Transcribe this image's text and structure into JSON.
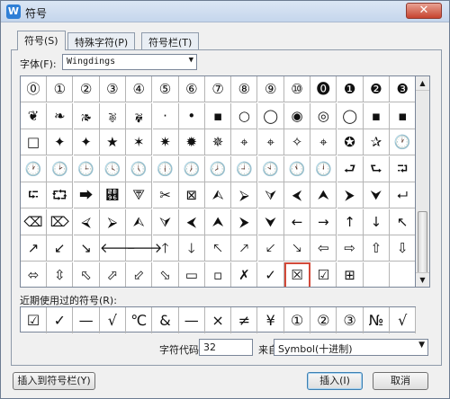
{
  "window": {
    "title": "符号",
    "app_icon": "W",
    "close_glyph": "✕"
  },
  "tabs": [
    {
      "label": "符号(S)"
    },
    {
      "label": "特殊字符(P)"
    },
    {
      "label": "符号栏(T)"
    }
  ],
  "font": {
    "label": "字体(F):",
    "value": "Wingdings",
    "dropdown_icon": "chevron-down-icon"
  },
  "symbol_grid": {
    "rows": [
      [
        "⓪",
        "①",
        "②",
        "③",
        "④",
        "⑤",
        "⑥",
        "⑦",
        "⑧",
        "⑨",
        "⑩",
        "⓿",
        "❶",
        "❷",
        "❸"
      ],
      [
        "❦",
        "❧",
        "🙕",
        "🙖",
        "🙗",
        "·",
        "•",
        "▪",
        "○",
        "◯",
        "◉",
        "◎",
        "◯",
        "▪",
        "▪"
      ],
      [
        "□",
        "✦",
        "✦",
        "★",
        "✶",
        "✷",
        "✹",
        "✵",
        "⌖",
        "⌖",
        "✧",
        "⌖",
        "✪",
        "✰",
        "🕐"
      ],
      [
        "🕐",
        "🕑",
        "🕒",
        "🕓",
        "🕔",
        "🕕",
        "🕖",
        "🕗",
        "🕘",
        "🕙",
        "🕚",
        "🕛",
        "⮐",
        "⮑",
        "⮒"
      ],
      [
        "⮓",
        "⮔",
        "⮕",
        "⮖",
        "⮗",
        "✂",
        "⊠",
        "⮙",
        "⮚",
        "⮛",
        "⮜",
        "⮝",
        "⮞",
        "⮟",
        "⮠"
      ],
      [
        "⌫",
        "⌦",
        "⮘",
        "⮚",
        "⮙",
        "⮛",
        "⮜",
        "⮝",
        "⮞",
        "⮟",
        "←",
        "→",
        "↑",
        "↓",
        "↖"
      ],
      [
        "↗",
        "↙",
        "↘",
        "🡐",
        "🡒",
        "🡑",
        "🡓",
        "🡔",
        "🡕",
        "🡗",
        "🡖",
        "⇦",
        "⇨",
        "⇧",
        "⇩"
      ],
      [
        "⬄",
        "⇳",
        "⬁",
        "⬀",
        "⬃",
        "⬂",
        "▭",
        "▫",
        "✗",
        "✓",
        "☒",
        "☑",
        "⊞",
        "",
        ""
      ]
    ],
    "selected_index": [
      7,
      10
    ]
  },
  "recent": {
    "label": "近期使用过的符号(R):",
    "symbols": [
      "☑",
      "✓",
      "—",
      "√",
      "℃",
      "&",
      "—",
      "×",
      "≠",
      "¥",
      "①",
      "②",
      "③",
      "№",
      "√"
    ]
  },
  "code": {
    "label": "字符代码(C):",
    "value": "32"
  },
  "from": {
    "label": "来自(M)",
    "value": "Symbol(十进制)"
  },
  "buttons": {
    "insert_to_bar": "插入到符号栏(Y)",
    "insert": "插入(I)",
    "cancel": "取消"
  }
}
